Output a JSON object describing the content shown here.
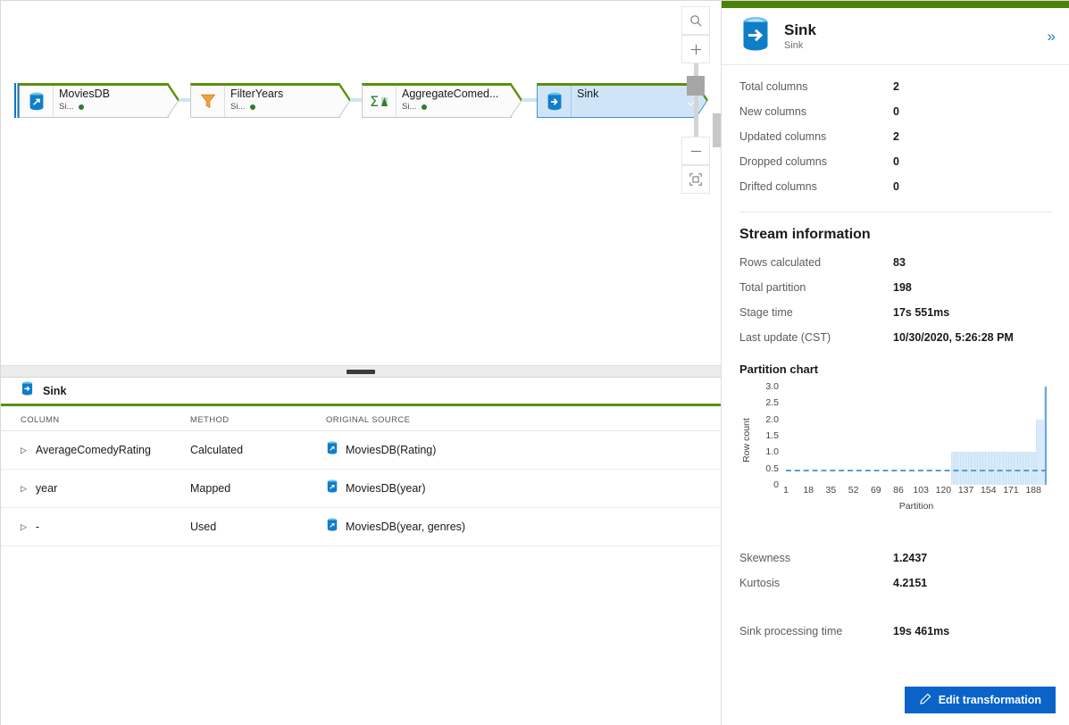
{
  "graph": {
    "nodes": [
      {
        "name": "MoviesDB",
        "sub": "Si...",
        "icon": "database-source-icon",
        "selected": false,
        "status": "ok"
      },
      {
        "name": "FilterYears",
        "sub": "Si...",
        "icon": "filter-icon",
        "selected": false,
        "status": "ok"
      },
      {
        "name": "AggregateComed...",
        "sub": "Si...",
        "icon": "aggregate-icon",
        "selected": false,
        "status": "ok"
      },
      {
        "name": "Sink",
        "sub": "",
        "icon": "database-sink-icon",
        "selected": true,
        "status": "ok"
      }
    ],
    "toolbar": {
      "search_label": "Search",
      "zoom_in_label": "+",
      "zoom_out_label": "–",
      "fit_label": "Fit to screen"
    }
  },
  "inspect": {
    "title": "Sink",
    "columns": [
      "COLUMN",
      "METHOD",
      "ORIGINAL SOURCE"
    ],
    "rows": [
      {
        "column": "AverageComedyRating",
        "method": "Calculated",
        "source": "MoviesDB(Rating)"
      },
      {
        "column": "year",
        "method": "Mapped",
        "source": "MoviesDB(year)"
      },
      {
        "column": "-",
        "method": "Used",
        "source": "MoviesDB(year, genres)"
      }
    ]
  },
  "panel": {
    "title": "Sink",
    "subtitle": "Sink",
    "collapse_label": "»",
    "column_stats": [
      {
        "label": "Total columns",
        "value": "2"
      },
      {
        "label": "New columns",
        "value": "0"
      },
      {
        "label": "Updated columns",
        "value": "2"
      },
      {
        "label": "Dropped columns",
        "value": "0"
      },
      {
        "label": "Drifted columns",
        "value": "0"
      }
    ],
    "stream_section": "Stream information",
    "stream_stats": [
      {
        "label": "Rows calculated",
        "value": "83"
      },
      {
        "label": "Total partition",
        "value": "198"
      },
      {
        "label": "Stage time",
        "value": "17s 551ms"
      },
      {
        "label": "Last update (CST)",
        "value": "10/30/2020, 5:26:28 PM"
      }
    ],
    "moment_stats": [
      {
        "label": "Skewness",
        "value": "1.2437"
      },
      {
        "label": "Kurtosis",
        "value": "4.2151"
      }
    ],
    "processing": {
      "label": "Sink processing time",
      "value": "19s 461ms"
    },
    "edit_button": "Edit transformation",
    "accent_green": "#4a8209",
    "accent_blue": "#0a63c9"
  },
  "chart_data": {
    "type": "bar",
    "title": "Partition chart",
    "xlabel": "Partition",
    "ylabel": "Row count",
    "xlim": [
      1,
      198
    ],
    "ylim": [
      0,
      3.0
    ],
    "yticks": [
      "0",
      "0.5",
      "1.0",
      "1.5",
      "2.0",
      "2.5",
      "3.0"
    ],
    "ytick_values": [
      0,
      0.5,
      1.0,
      1.5,
      2.0,
      2.5,
      3.0
    ],
    "xticks": [
      1,
      18,
      35,
      52,
      69,
      86,
      103,
      120,
      137,
      154,
      171,
      188
    ],
    "grid": false,
    "bar_color": "#d9ebfa",
    "average_line": {
      "value": 0.42,
      "color": "#5b9bd5",
      "style": "dashed"
    },
    "segments": [
      {
        "x_start": 1,
        "x_end": 126,
        "value": 0
      },
      {
        "x_start": 126,
        "x_end": 190,
        "value": 1.0
      },
      {
        "x_start": 190,
        "x_end": 196,
        "value": 2.0
      },
      {
        "x_start": 196,
        "x_end": 198,
        "value": 3.0
      }
    ]
  }
}
